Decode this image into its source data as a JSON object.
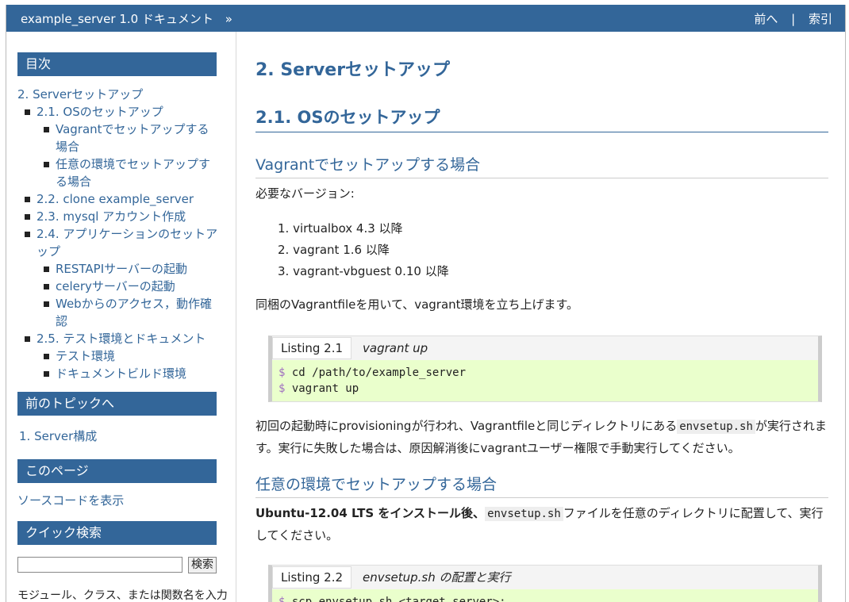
{
  "topbar": {
    "home_label": "example_server 1.0 ドキュメント",
    "home_sep": "»",
    "prev_label": "前へ",
    "separator": "|",
    "index_label": "索引"
  },
  "sidebar": {
    "toc_heading": "目次",
    "toc": [
      {
        "label": "2. Serverセットアップ",
        "level": 0
      },
      {
        "label": "2.1. OSのセットアップ",
        "level": 1
      },
      {
        "label": "Vagrantでセットアップする場合",
        "level": 2
      },
      {
        "label": "任意の環境でセットアップする場合",
        "level": 2
      },
      {
        "label": "2.2. clone example_server",
        "level": 1
      },
      {
        "label": "2.3. mysql アカウント作成",
        "level": 1
      },
      {
        "label": "2.4. アプリケーションのセットアップ",
        "level": 1
      },
      {
        "label": "RESTAPIサーバーの起動",
        "level": 2
      },
      {
        "label": "celeryサーバーの起動",
        "level": 2
      },
      {
        "label": "Webからのアクセス，動作確認",
        "level": 2
      },
      {
        "label": "2.5. テスト環境とドキュメント",
        "level": 1
      },
      {
        "label": "テスト環境",
        "level": 2
      },
      {
        "label": "ドキュメントビルド環境",
        "level": 2
      }
    ],
    "prev_heading": "前のトピックへ",
    "prev_link": "1. Server構成",
    "page_heading": "このページ",
    "source_link": "ソースコードを表示",
    "search_heading": "クイック検索",
    "search_value": "",
    "search_button": "検索",
    "search_hint": "モジュール、クラス、または関数名を入力"
  },
  "main": {
    "h1": "2. Serverセットアップ",
    "h2": "2.1. OSのセットアップ",
    "h3_vagrant": "Vagrantでセットアップする場合",
    "required_label": "必要なバージョン:",
    "versions": [
      "virtualbox 4.3 以降",
      "vagrant 1.6 以降",
      "vagrant-vbguest 0.10 以降"
    ],
    "vagrant_para": "同梱のVagrantfileを用いて、vagrant環境を立ち上げます。",
    "listing1": {
      "num": "Listing 2.1",
      "title": "vagrant up",
      "lines": [
        {
          "prompt": "$",
          "cmd": "cd /path/to/example_server"
        },
        {
          "prompt": "$",
          "cmd": "vagrant up"
        }
      ]
    },
    "provision_para_a": "初回の起動時にprovisioningが行われ、Vagrantfileと同じディレクトリにある",
    "provision_code": "envsetup.sh",
    "provision_para_b": "が実行されます。実行に失敗した場合は、原因解消後にvagrantユーザー権限で手動実行してください。",
    "h3_any": "任意の環境でセットアップする場合",
    "ubuntu_para_a": "Ubuntu-12.04 LTS をインストール後、",
    "ubuntu_code": "envsetup.sh",
    "ubuntu_para_b": "ファイルを任意のディレクトリに配置して、実行してください。",
    "listing2": {
      "num": "Listing 2.2",
      "title": "envsetup.sh の配置と実行",
      "lines": [
        {
          "prompt": "$",
          "cmd": "scp envsetup.sh <target server>:"
        }
      ]
    }
  }
}
